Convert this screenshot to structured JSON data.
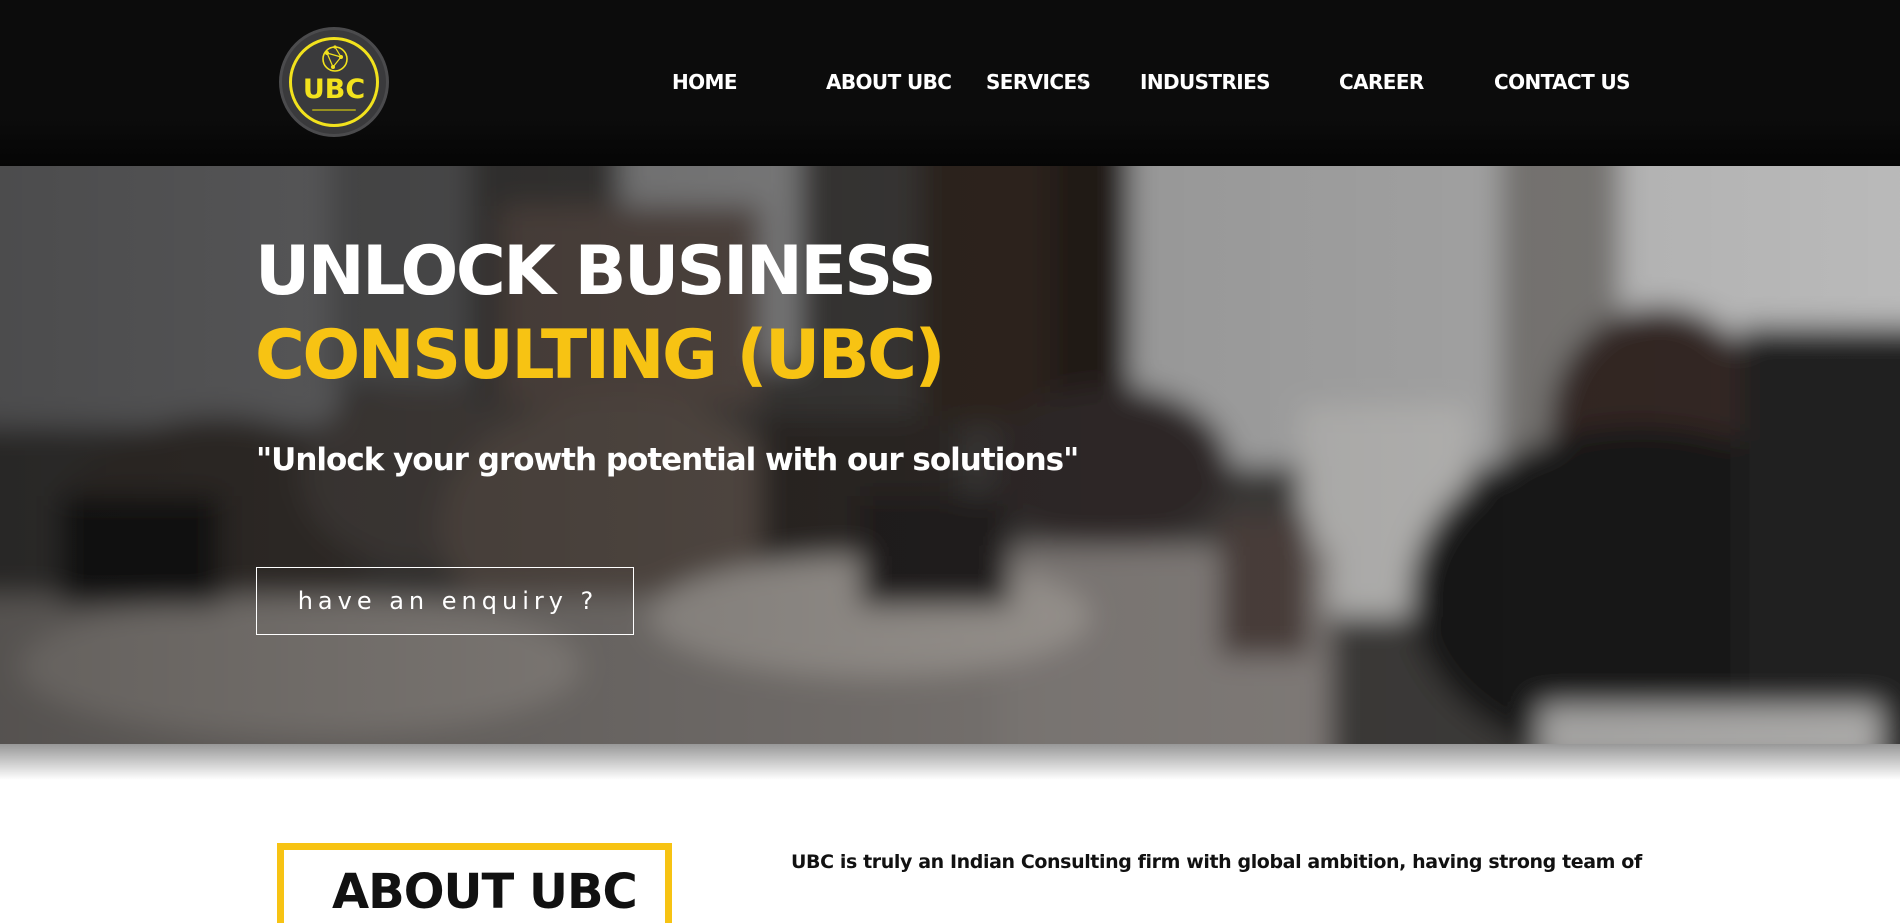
{
  "logo": {
    "text": "UBC",
    "brand_color": "#f2e21d",
    "icon": "globe-network-icon"
  },
  "nav": {
    "items": [
      {
        "label": "HOME"
      },
      {
        "label": "ABOUT UBC"
      },
      {
        "label": "SERVICES",
        "has_dropdown": true,
        "icon": "chevron-down-icon"
      },
      {
        "label": "INDUSTRIES"
      },
      {
        "label": "CAREER"
      },
      {
        "label": "CONTACT US"
      }
    ]
  },
  "hero": {
    "title_line1": "UNLOCK BUSINESS",
    "title_line2": "CONSULTING (UBC)",
    "tagline": "\"Unlock your growth potential with our solutions\"",
    "cta_label": "have an enquiry ?",
    "accent_color": "#f7c313",
    "background": "blurred office photo"
  },
  "about": {
    "heading": "ABOUT UBC",
    "text": "UBC is truly an Indian Consulting firm with global ambition, having strong team of"
  }
}
